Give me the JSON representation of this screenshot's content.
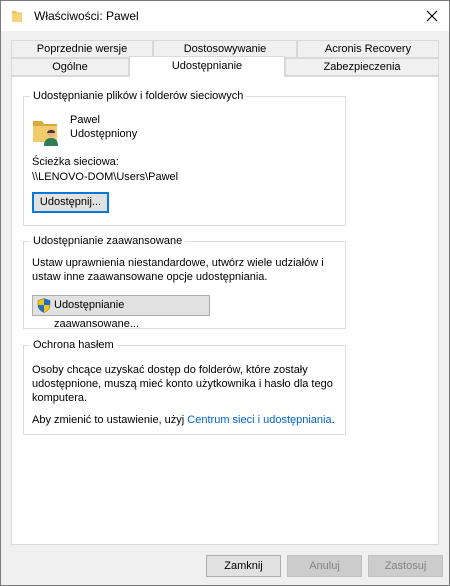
{
  "window": {
    "title": "Właściwości: Pawel",
    "folder_icon": "folder-icon",
    "close_icon": "close-icon"
  },
  "tabs": {
    "row_top": [
      "Poprzednie wersje",
      "Dostosowywanie",
      "Acronis Recovery"
    ],
    "row_bottom": [
      "Ogólne",
      "Udostępnianie",
      "Zabezpieczenia"
    ],
    "active": "Udostępnianie"
  },
  "network_sharing": {
    "title": "Udostępnianie plików i folderów sieciowych",
    "item_name": "Pawel",
    "item_status": "Udostępniony",
    "path_label": "Ścieżka sieciowa:",
    "path_value": "\\\\LENOVO-DOM\\Users\\Pawel",
    "share_button": "Udostępnij...",
    "icon": "shared-folder-user-icon"
  },
  "advanced_sharing": {
    "title": "Udostępnianie zaawansowane",
    "description_line1": "Ustaw uprawnienia niestandardowe, utwórz wiele udziałów i",
    "description_line2": "ustaw inne zaawansowane opcje udostępniania.",
    "button": "Udostępnianie zaawansowane...",
    "button_icon": "uac-shield-icon"
  },
  "password_protection": {
    "title": "Ochrona hasłem",
    "line1": "Osoby chcące uzyskać dostęp do folderów, które zostały",
    "line2": "udostępnione, muszą mieć konto użytkownika i hasło dla tego",
    "line3": "komputera.",
    "change_prefix": "Aby zmienić to ustawienie, użyj ",
    "link": "Centrum sieci i udostępniania",
    "change_suffix": "."
  },
  "footer": {
    "close": "Zamknij",
    "cancel": "Anuluj",
    "apply": "Zastosuj"
  },
  "colors": {
    "accent": "#0078d7",
    "link": "#0066cc",
    "folder": "#e8c25a"
  }
}
